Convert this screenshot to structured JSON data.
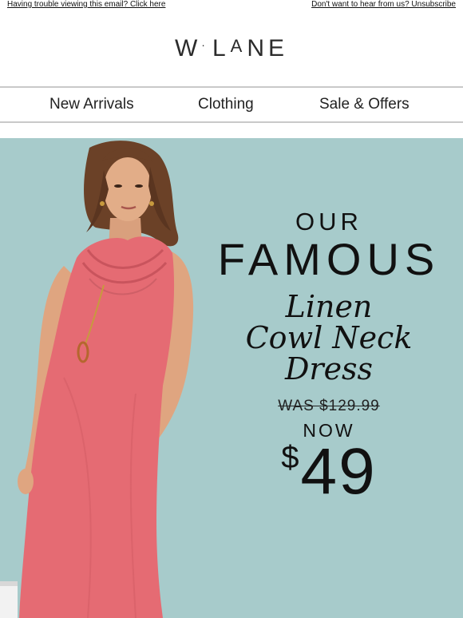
{
  "header": {
    "trouble_link": "Having trouble viewing this email? Click here",
    "unsubscribe_link": "Don't want to hear from us? Unsubscribe"
  },
  "logo": {
    "w": "W",
    "dot": "·",
    "l": "L",
    "a": "A",
    "n": "N",
    "e": "E"
  },
  "nav": {
    "items": [
      "New Arrivals",
      "Clothing",
      "Sale & Offers"
    ]
  },
  "hero": {
    "line1": "OUR",
    "line2": "FAMOUS",
    "product_line1": "Linen",
    "product_line2": "Cowl Neck",
    "product_line3": "Dress",
    "was_price": "WAS $129.99",
    "now_label": "NOW",
    "currency": "$",
    "now_price": "49"
  },
  "colors": {
    "hero_background": "#a7cbcb",
    "dress": "#e56b73"
  }
}
